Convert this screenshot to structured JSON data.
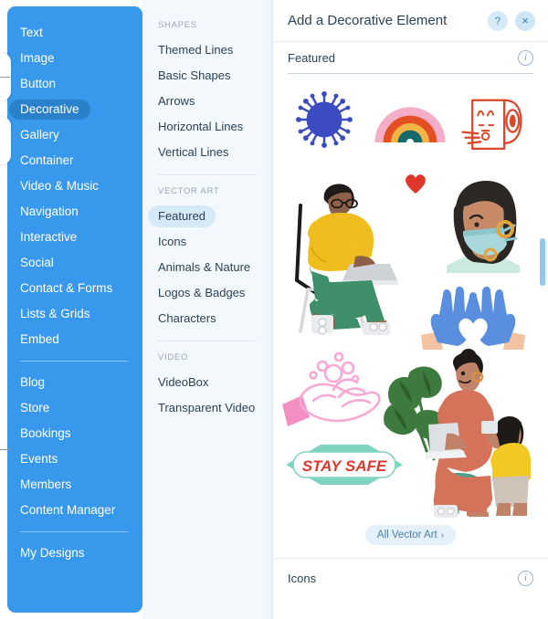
{
  "sidebar": {
    "groups": [
      {
        "items": [
          {
            "label": "Text",
            "active": false
          },
          {
            "label": "Image",
            "active": false
          },
          {
            "label": "Button",
            "active": false
          },
          {
            "label": "Decorative",
            "active": true
          },
          {
            "label": "Gallery",
            "active": false
          },
          {
            "label": "Container",
            "active": false
          },
          {
            "label": "Video & Music",
            "active": false
          },
          {
            "label": "Navigation",
            "active": false
          },
          {
            "label": "Interactive",
            "active": false
          },
          {
            "label": "Social",
            "active": false
          },
          {
            "label": "Contact & Forms",
            "active": false
          },
          {
            "label": "Lists & Grids",
            "active": false
          },
          {
            "label": "Embed",
            "active": false
          }
        ]
      },
      {
        "items": [
          {
            "label": "Blog",
            "active": false
          },
          {
            "label": "Store",
            "active": false
          },
          {
            "label": "Bookings",
            "active": false
          },
          {
            "label": "Events",
            "active": false
          },
          {
            "label": "Members",
            "active": false
          },
          {
            "label": "Content Manager",
            "active": false
          }
        ]
      },
      {
        "items": [
          {
            "label": "My Designs",
            "active": false
          }
        ]
      }
    ]
  },
  "categories": {
    "sections": [
      {
        "heading": "SHAPES",
        "items": [
          {
            "label": "Themed Lines",
            "active": false
          },
          {
            "label": "Basic Shapes",
            "active": false
          },
          {
            "label": "Arrows",
            "active": false
          },
          {
            "label": "Horizontal Lines",
            "active": false
          },
          {
            "label": "Vertical Lines",
            "active": false
          }
        ]
      },
      {
        "heading": "VECTOR ART",
        "items": [
          {
            "label": "Featured",
            "active": true
          },
          {
            "label": "Icons",
            "active": false
          },
          {
            "label": "Animals & Nature",
            "active": false
          },
          {
            "label": "Logos & Badges",
            "active": false
          },
          {
            "label": "Characters",
            "active": false
          }
        ]
      },
      {
        "heading": "VIDEO",
        "items": [
          {
            "label": "VideoBox",
            "active": false
          },
          {
            "label": "Transparent Video",
            "active": false
          }
        ]
      }
    ]
  },
  "panel": {
    "title": "Add a Decorative Element",
    "help_label": "?",
    "close_label": "×",
    "featured_section": {
      "title": "Featured",
      "info_label": "i"
    },
    "all_vector_art": {
      "label": "All Vector Art",
      "chevron": "›"
    },
    "icons_section": {
      "title": "Icons",
      "info_label": "i"
    },
    "artwork": [
      {
        "name": "virus-illustration",
        "alt": "blue coronavirus"
      },
      {
        "name": "rainbow-illustration",
        "alt": "rainbow arch"
      },
      {
        "name": "toilet-paper-illustration",
        "alt": "toilet paper roll line art"
      },
      {
        "name": "man-with-laptop-illustration",
        "alt": "man in yellow sweater on chair with laptop"
      },
      {
        "name": "heart-illustration",
        "alt": "small red heart"
      },
      {
        "name": "masked-woman-illustration",
        "alt": "woman wearing a surgical mask"
      },
      {
        "name": "gloved-hands-heart-illustration",
        "alt": "blue gloved hands forming a heart"
      },
      {
        "name": "washing-hands-illustration",
        "alt": "pink line art washing hands with soap"
      },
      {
        "name": "mother-and-child-illustration",
        "alt": "woman on stool with laptop and child"
      },
      {
        "name": "stay-safe-badge",
        "alt": "STAY SAFE badge",
        "text": "STAY SAFE"
      }
    ]
  },
  "colors": {
    "sidebar_blue": "#3899ec",
    "sidebar_active": "#2b81c9",
    "category_bg": "#f3f8fc",
    "category_active": "#d6e9f7",
    "accent_text": "#2b4255",
    "scrollbar": "#8ec8f0"
  }
}
